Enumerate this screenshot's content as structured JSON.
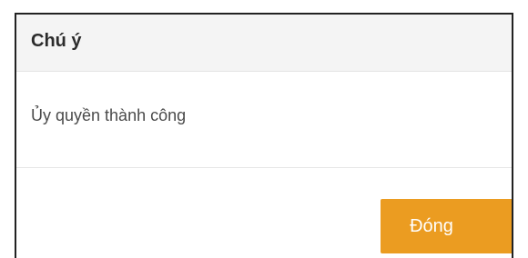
{
  "dialog": {
    "title": "Chú ý",
    "message": "Ủy quyền thành công",
    "close_label": "Đóng"
  },
  "colors": {
    "header_background": "#f4f4f4",
    "button_accent": "#eb9c21",
    "button_text": "#ffffff"
  }
}
